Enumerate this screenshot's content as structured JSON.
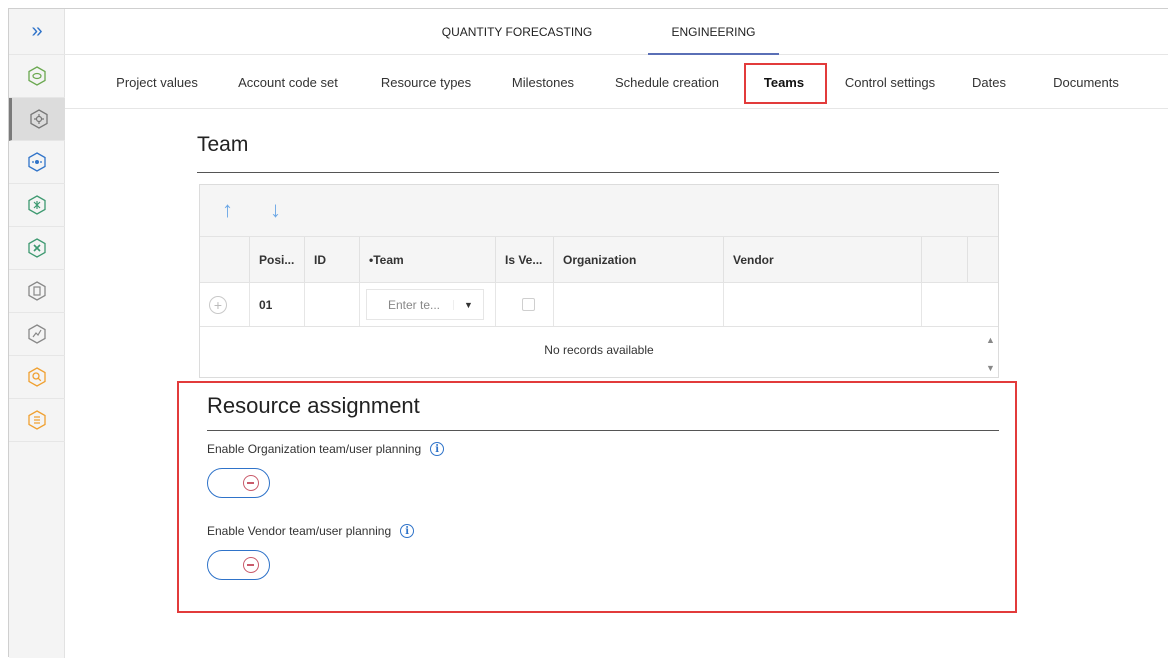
{
  "sidebar": {
    "toggle_icon": "double-chevron-right-icon",
    "items": [
      {
        "icon": "hexagon-icon",
        "color": "#6aa84f"
      },
      {
        "icon": "gear-hexagon-icon",
        "color": "#777777"
      },
      {
        "icon": "node-hexagon-icon",
        "color": "#2f73c9"
      },
      {
        "icon": "cluster-hexagon-icon",
        "color": "#3d9970"
      },
      {
        "icon": "cross-hexagon-icon",
        "color": "#3d9970"
      },
      {
        "icon": "document-hexagon-icon",
        "color": "#888888"
      },
      {
        "icon": "chart-hexagon-icon",
        "color": "#888888"
      },
      {
        "icon": "search-hexagon-icon",
        "color": "#f0a030"
      },
      {
        "icon": "list-hexagon-icon",
        "color": "#f0a030"
      }
    ]
  },
  "module_tabs": [
    {
      "label": "QUANTITY FORECASTING",
      "active": false
    },
    {
      "label": "ENGINEERING",
      "active": true
    }
  ],
  "sub_tabs": [
    {
      "label": "Project values"
    },
    {
      "label": "Account code set"
    },
    {
      "label": "Resource types"
    },
    {
      "label": "Milestones"
    },
    {
      "label": "Schedule creation"
    },
    {
      "label": "Teams",
      "active": true
    },
    {
      "label": "Control settings"
    },
    {
      "label": "Dates"
    },
    {
      "label": "Documents"
    }
  ],
  "team_section": {
    "title": "Team",
    "columns": [
      "Posi...",
      "ID",
      "•Team",
      "Is Ve...",
      "Organization",
      "Vendor"
    ],
    "row": {
      "position": "01",
      "team_placeholder": "Enter te..."
    },
    "empty_message": "No records available"
  },
  "resource_assignment": {
    "title": "Resource assignment",
    "options": [
      {
        "label": "Enable Organization team/user planning",
        "enabled": false
      },
      {
        "label": "Enable Vendor team/user planning",
        "enabled": false
      }
    ]
  },
  "colors": {
    "accent": "#2f73c9",
    "highlight": "#e23b3b",
    "tab_underline": "#5a6fb6"
  }
}
